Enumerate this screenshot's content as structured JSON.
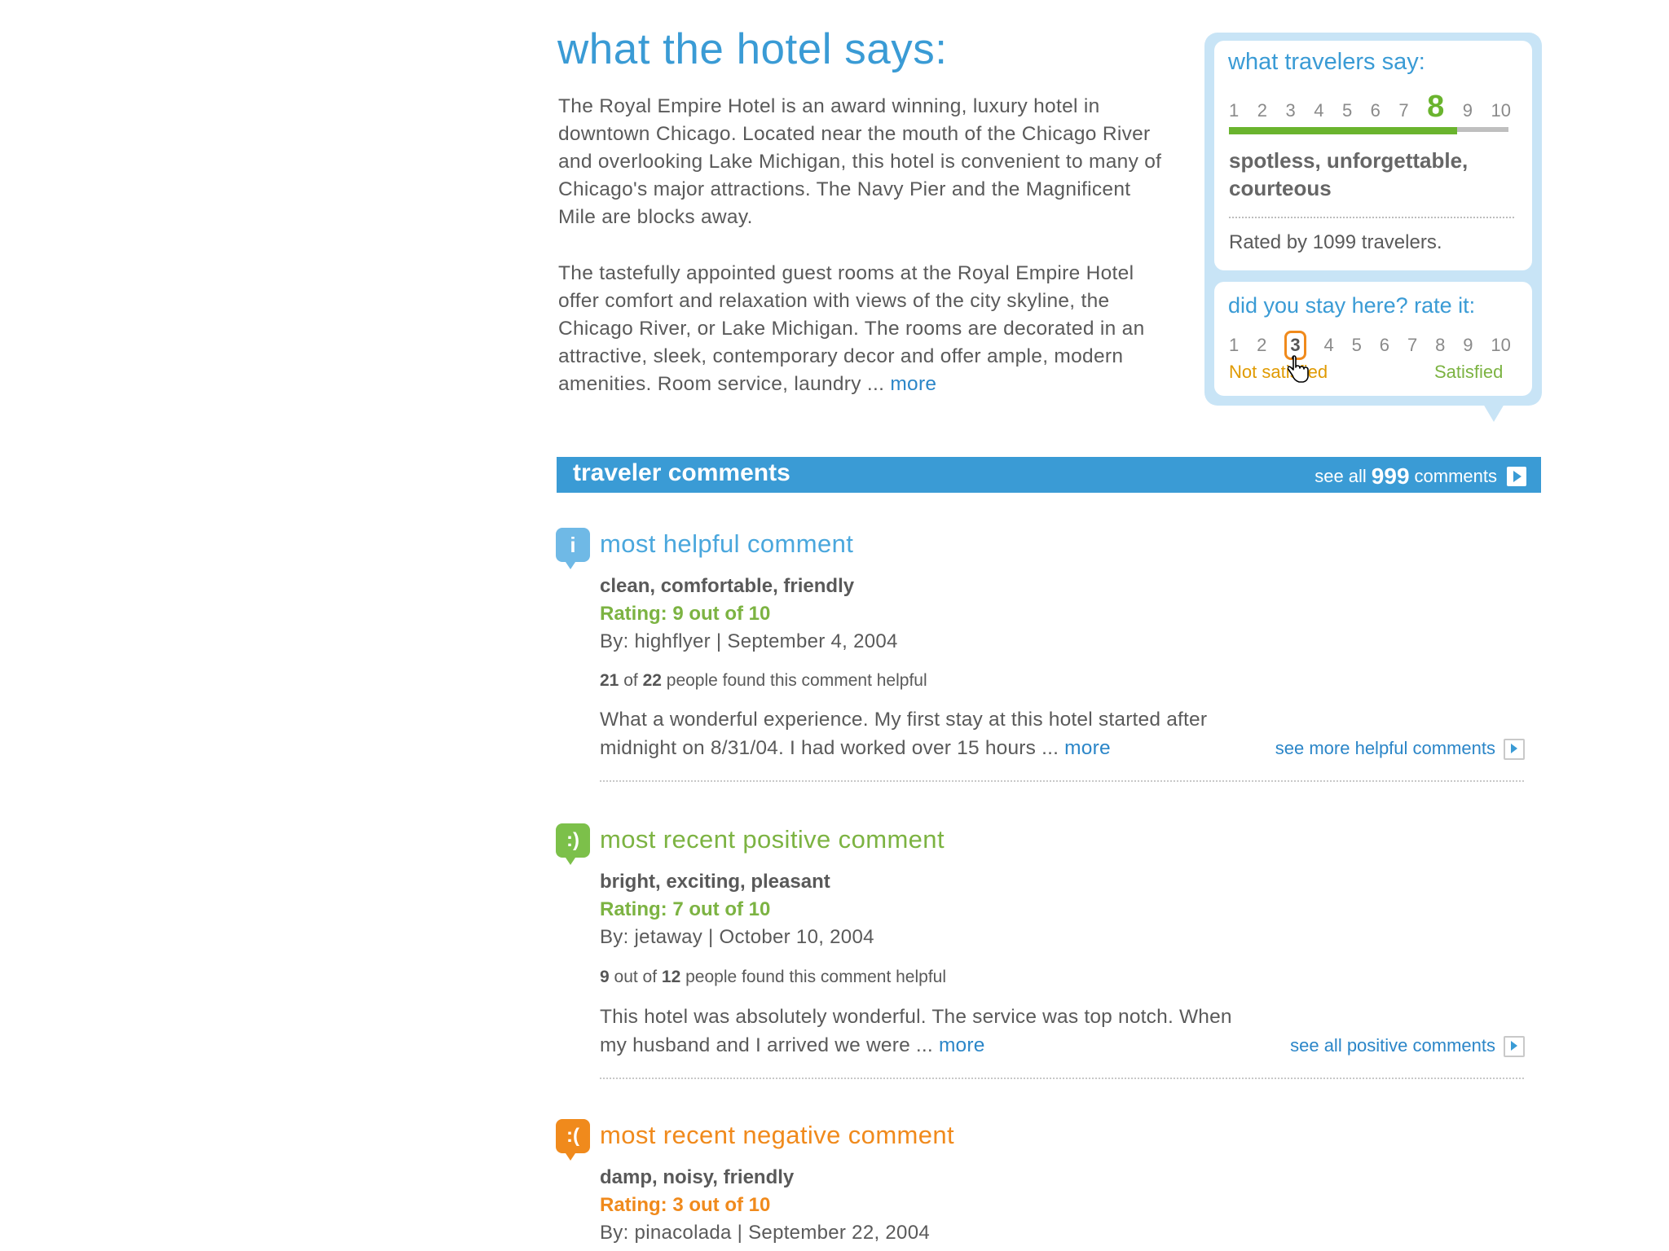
{
  "hotel": {
    "title": "what the hotel says:",
    "para1": "The Royal Empire Hotel is an award winning, luxury hotel in downtown Chicago. Located near the mouth of the Chicago River and overlooking Lake Michigan, this hotel is convenient to many of Chicago's major attractions. The Navy Pier and the Magnificent Mile are blocks away.",
    "para2": "The tastefully appointed guest rooms at the Royal Empire Hotel offer comfort and relaxation with views of the city skyline, the Chicago River, or Lake Michigan. The rooms are decorated in an attractive, sleek, contemporary decor and offer ample, modern amenities. Room service, laundry ...",
    "more": "more"
  },
  "travelers": {
    "title": "what travelers say:",
    "scale": [
      "1",
      "2",
      "3",
      "4",
      "5",
      "6",
      "7",
      "8",
      "9",
      "10"
    ],
    "score": 8,
    "score_fraction": 0.8,
    "descriptors": "spotless, unforgettable, courteous",
    "rated_by": "Rated by 1099 travelers."
  },
  "rate": {
    "title": "did you stay here? rate it:",
    "scale": [
      "1",
      "2",
      "3",
      "4",
      "5",
      "6",
      "7",
      "8",
      "9",
      "10"
    ],
    "selected": 3,
    "low_label": "Not satisfied",
    "high_label": "Satisfied"
  },
  "comments_bar": {
    "title": "traveler comments",
    "see_all_prefix": "see all",
    "count": "999",
    "see_all_suffix": "comments"
  },
  "comments": [
    {
      "icon": "info-icon",
      "icon_glyph": "i",
      "heading": "most helpful comment",
      "words": "clean, comfortable, friendly",
      "rating": "Rating: 9 out of 10",
      "by": "By: highflyer  |  September 4, 2004",
      "helpful_a": "21",
      "helpful_mid": "of",
      "helpful_b": "22",
      "helpful_suffix": "people found this comment helpful",
      "text": "What a wonderful experience. My first stay at this hotel started after midnight on 8/31/04. I had worked over 15 hours ...",
      "more": "more",
      "see_link": "see more helpful comments",
      "color": "#4aa7dd"
    },
    {
      "icon": "smile-icon",
      "icon_glyph": ":)",
      "heading": "most recent positive comment",
      "words": "bright, exciting, pleasant",
      "rating": "Rating: 7 out of 10",
      "by": "By: jetaway  |  October 10, 2004",
      "helpful_a": "9",
      "helpful_mid": "out of",
      "helpful_b": "12",
      "helpful_suffix": "people found this comment helpful",
      "text": "This hotel was absolutely wonderful. The service was top notch. When my husband and I arrived we were ...",
      "more": "more",
      "see_link": "see all positive comments",
      "color": "#7cb342"
    },
    {
      "icon": "frown-icon",
      "icon_glyph": ":(",
      "heading": "most recent negative comment",
      "words": "damp, noisy, friendly",
      "rating": "Rating: 3 out of 10",
      "by": "By: pinacolada  |  September 22, 2004",
      "color": "#f08a1c"
    }
  ]
}
